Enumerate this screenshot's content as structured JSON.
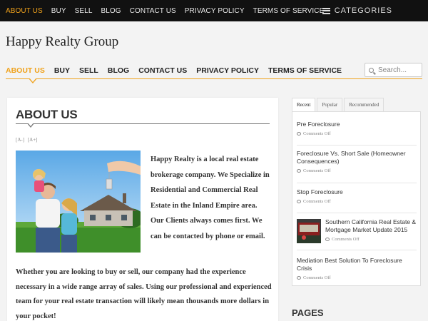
{
  "topnav": [
    "ABOUT US",
    "BUY",
    "SELL",
    "BLOG",
    "CONTACT US",
    "PRIVACY POLICY",
    "TERMS OF SERVICE"
  ],
  "categories_label": "CATEGORIES",
  "site_title": "Happy Realty Group",
  "mainnav": [
    "ABOUT US",
    "BUY",
    "SELL",
    "BLOG",
    "CONTACT US",
    "PRIVACY POLICY",
    "TERMS OF SERVICE"
  ],
  "search": {
    "placeholder": "Search..."
  },
  "page": {
    "title": "ABOUT US",
    "font_decrease": "[A-]",
    "font_increase": "[A+]",
    "intro": "Happy Realty is a local real estate brokerage company. We Specialize in Residential and Commercial Real Estate in the Inland Empire area. Our Clients always comes first. We can be contacted by phone or email.",
    "paragraph": " Whether you are looking to buy or sell, our company had the experience necessary in a wide range array of sales. Using our professional and experienced team for your real estate transaction will likely mean thousands more dollars in your pocket!"
  },
  "sidebar": {
    "tabs": [
      "Recent",
      "Popular",
      "Recommended"
    ],
    "posts": [
      {
        "title": "Pre Foreclosure",
        "comments": "Comments Off"
      },
      {
        "title": "Foreclosure Vs. Short Sale (Homeowner Consequences)",
        "comments": "Comments Off"
      },
      {
        "title": "Stop Foreclosure",
        "comments": "Comments Off"
      },
      {
        "title": "Southern California Real Estate & Mortgage Market Update 2015",
        "comments": "Comments Off"
      },
      {
        "title": "Mediation Best Solution To Foreclosure Crisis",
        "comments": "Comments Off"
      }
    ],
    "pages_heading": "PAGES"
  },
  "colors": {
    "accent": "#f0a21c",
    "topbar": "#111111"
  }
}
